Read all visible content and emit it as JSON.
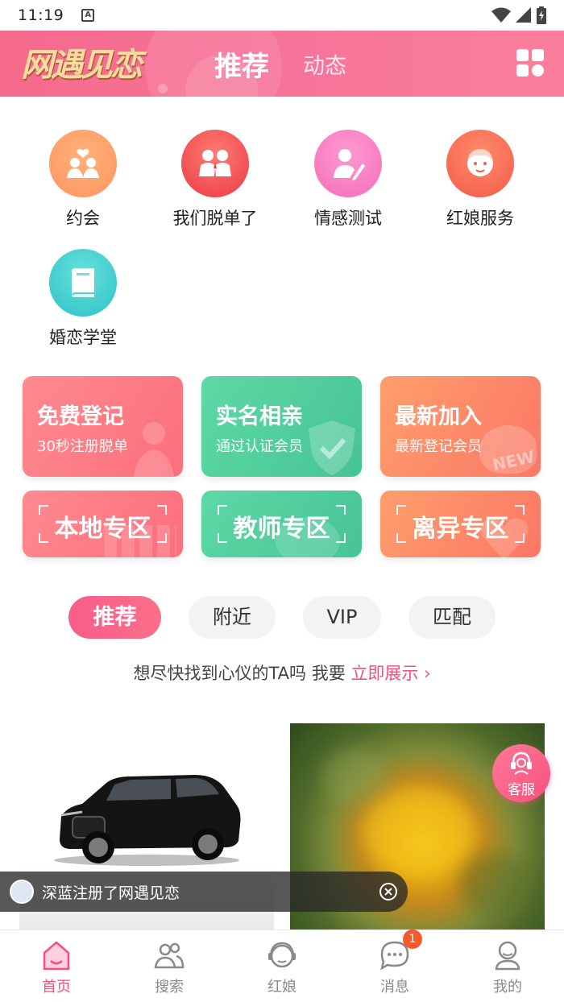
{
  "status_bar": {
    "time": "11:19",
    "notification_icon": "A"
  },
  "header": {
    "logo_text": "网遇见恋",
    "tabs": [
      {
        "label": "推荐",
        "active": true
      },
      {
        "label": "动态",
        "active": false
      }
    ],
    "menu_icon": "grid-icon",
    "color_start": "#f66a8b",
    "color_end": "#fb7f9c"
  },
  "features": [
    {
      "label": "约会",
      "icon": "couple-icon",
      "color": "#ffa06c"
    },
    {
      "label": "我们脱单了",
      "icon": "pair-icon",
      "color": "#f5484e"
    },
    {
      "label": "情感测试",
      "icon": "test-pencil-icon",
      "color": "#f97bc0"
    },
    {
      "label": "红娘服务",
      "icon": "matchmaker-icon",
      "color": "#fa6a55"
    },
    {
      "label": "婚恋学堂",
      "icon": "book-icon",
      "color": "#3fcdcf"
    }
  ],
  "cards_big": [
    {
      "title": "免费登记",
      "subtitle": "30秒注册脱单",
      "theme": "pink"
    },
    {
      "title": "实名相亲",
      "subtitle": "通过认证会员",
      "theme": "green"
    },
    {
      "title": "最新加入",
      "subtitle": "最新登记会员",
      "theme": "orange",
      "watermark": "NEW"
    }
  ],
  "cards_small": [
    {
      "title": "本地专区",
      "theme": "pink"
    },
    {
      "title": "教师专区",
      "theme": "green"
    },
    {
      "title": "离异专区",
      "theme": "orange"
    }
  ],
  "filters": [
    {
      "label": "推荐",
      "active": true
    },
    {
      "label": "附近",
      "active": false
    },
    {
      "label": "VIP",
      "active": false
    },
    {
      "label": "匹配",
      "active": false
    }
  ],
  "promo": {
    "text": "想尽快找到心仪的TA吗 我要 ",
    "link": "立即展示",
    "chevron": "›"
  },
  "service_button": {
    "label": "客服",
    "icon": "headset-icon"
  },
  "toast": {
    "text": "深蓝注册了网遇见恋",
    "close_icon": "close-circle-icon"
  },
  "bottom_nav": [
    {
      "label": "首页",
      "icon": "home-icon",
      "active": true
    },
    {
      "label": "搜索",
      "icon": "people-search-icon",
      "active": false
    },
    {
      "label": "红娘",
      "icon": "matchmaker-nav-icon",
      "active": false
    },
    {
      "label": "消息",
      "icon": "message-icon",
      "active": false,
      "badge": "1"
    },
    {
      "label": "我的",
      "icon": "profile-icon",
      "active": false
    }
  ],
  "accent_color": "#f6507d"
}
